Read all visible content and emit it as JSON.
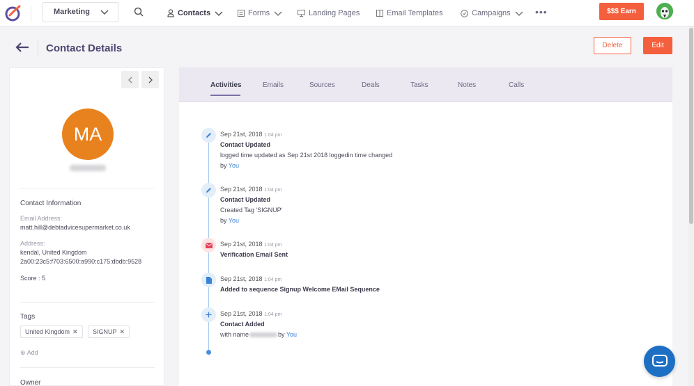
{
  "topnav": {
    "app_select": "Marketing",
    "items": [
      {
        "label": "Contacts",
        "icon": "user-icon"
      },
      {
        "label": "Forms",
        "icon": "form-icon"
      },
      {
        "label": "Landing Pages",
        "icon": "monitor-icon"
      },
      {
        "label": "Email Templates",
        "icon": "template-icon"
      },
      {
        "label": "Campaigns",
        "icon": "campaign-icon"
      }
    ],
    "more": "•••",
    "earn_label": "$$$ Earn"
  },
  "header": {
    "title": "Contact Details",
    "delete_label": "Delete",
    "edit_label": "Edit"
  },
  "contact": {
    "initials": "MA",
    "info_title": "Contact Information",
    "email_label": "Email Address:",
    "email": "matt.hill@debtadvicesupermarket.co.uk",
    "address_label": "Address:",
    "address_line1": "kendal, United Kingdom",
    "address_line2": "2a00:23c5:f703:6500:a990:c175:dbdb:9528",
    "score": "Score : 5",
    "tags_title": "Tags",
    "tags": [
      "United Kingdom",
      "SIGNUP"
    ],
    "add_label": "Add",
    "owner_title": "Owner"
  },
  "tabs": [
    "Activities",
    "Emails",
    "Sources",
    "Deals",
    "Tasks",
    "Notes",
    "Calls"
  ],
  "timeline": [
    {
      "icon": "pencil-icon",
      "date": "Sep 21st, 2018",
      "time": "1:04 pm",
      "title": "Contact Updated",
      "text": "logged time updated as Sep 21st 2018 loggedin time changed",
      "by_prefix": "by ",
      "by": "You"
    },
    {
      "icon": "pencil-icon",
      "date": "Sep 21st, 2018",
      "time": "1:04 pm",
      "title": "Contact Updated",
      "text": "Created Tag 'SIGNUP'",
      "by_prefix": "by ",
      "by": "You"
    },
    {
      "icon": "envelope-icon",
      "date": "Sep 21st, 2018",
      "time": "1:04 pm",
      "title": "Verification Email Sent"
    },
    {
      "icon": "document-icon",
      "date": "Sep 21st, 2018",
      "time": "1:04 pm",
      "title": "Added to sequence Signup Welcome EMail Sequence"
    },
    {
      "icon": "plus-icon",
      "date": "Sep 21st, 2018",
      "time": "1:04 pm",
      "title": "Contact Added",
      "text": "with name",
      "by_prefix": "by ",
      "by": "You"
    }
  ],
  "colors": {
    "accent": "#f4603e",
    "brand": "#4c4470",
    "link": "#3b82d6",
    "avatar": "#e8821f"
  }
}
